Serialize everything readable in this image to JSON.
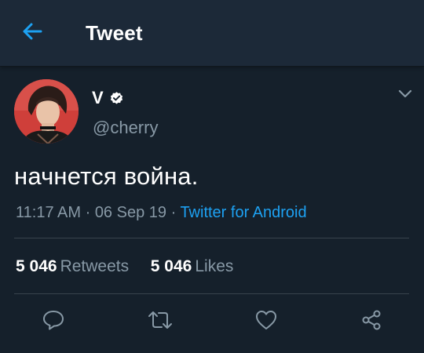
{
  "header": {
    "title": "Tweet",
    "back_icon": "arrow-left-icon"
  },
  "tweet": {
    "display_name": "V",
    "verified": true,
    "handle": "@cherry",
    "text": "начнется война.",
    "time": "11:17 AM",
    "date": "06 Sep 19",
    "app": "Twitter for Android",
    "retweets": "5 046",
    "retweets_label": "Retweets",
    "likes": "5 046",
    "likes_label": "Likes"
  },
  "actions": [
    "reply-icon",
    "retweet-icon",
    "like-icon",
    "share-icon"
  ],
  "colors": {
    "background": "#15202b",
    "header": "#1c2938",
    "accent": "#1da1f2",
    "muted": "#8899a6",
    "divider": "#38444d"
  }
}
